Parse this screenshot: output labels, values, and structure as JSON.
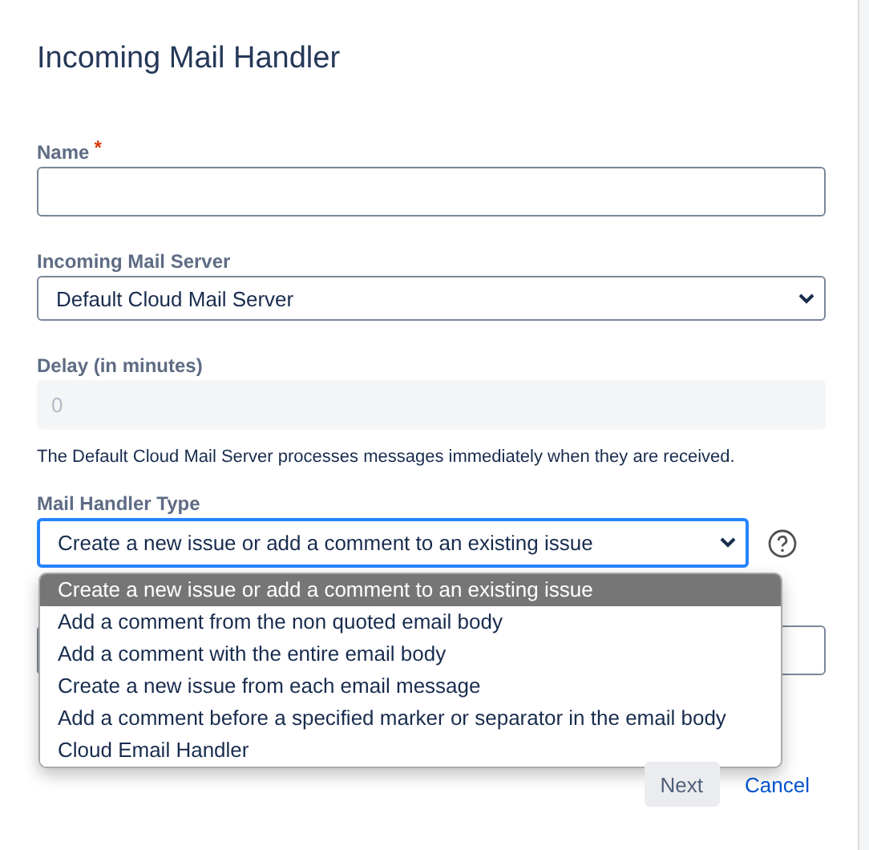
{
  "dialog": {
    "title": "Incoming Mail Handler"
  },
  "fields": [
    {
      "kind": "text",
      "label": "Name",
      "required_mark": "*",
      "disabled": false
    },
    {
      "kind": "select",
      "label": "Incoming Mail Server",
      "value": "Default Cloud Mail Server",
      "focused": false
    },
    {
      "kind": "text",
      "label": "Delay (in minutes)",
      "placeholder": "0",
      "disabled": true,
      "description": "The Default Cloud Mail Server processes messages immediately when they are received."
    },
    {
      "kind": "select",
      "label": "Mail Handler Type",
      "value": "Create a new issue or add a comment to an existing issue",
      "focused": true,
      "expanded": true,
      "help_button": true,
      "options": [
        {
          "label": "Create a new issue or add a comment to an existing issue",
          "selected": true
        },
        {
          "label": "Add a comment from the non quoted email body",
          "selected": false
        },
        {
          "label": "Add a comment with the entire email body",
          "selected": false
        },
        {
          "label": "Create a new issue from each email message",
          "selected": false
        },
        {
          "label": "Add a comment before a specified marker or separator in the email body",
          "selected": false
        },
        {
          "label": "Cloud Email Handler",
          "selected": false
        }
      ]
    },
    {
      "kind": "text",
      "disabled": false
    }
  ],
  "buttons": [
    {
      "kind": "button",
      "label": "Next"
    },
    {
      "kind": "link",
      "label": "Cancel"
    }
  ]
}
